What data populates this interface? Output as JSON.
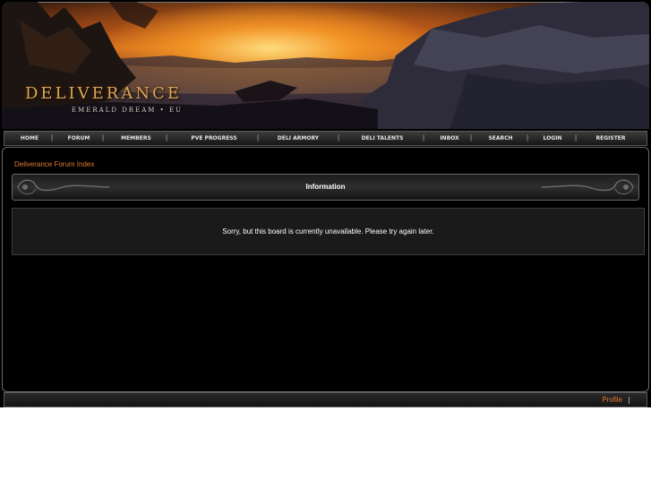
{
  "banner": {
    "logo_text": "DELIVERANCE",
    "tagline": "EMERALD DREAM • EU"
  },
  "nav": {
    "items": [
      {
        "label": "HOME"
      },
      {
        "label": "FORUM"
      },
      {
        "label": "MEMBERS"
      },
      {
        "label": "PVE PROGRESS"
      },
      {
        "label": "DELI ARMORY"
      },
      {
        "label": "DELI TALENTS"
      },
      {
        "label": "INBOX"
      },
      {
        "label": "SEARCH"
      },
      {
        "label": "LOGIN"
      },
      {
        "label": "REGISTER"
      }
    ],
    "separator": "|"
  },
  "main": {
    "breadcrumb": "Deliverance Forum Index",
    "info_title": "Information",
    "message": "Sorry, but this board is currently unavailable. Please try again later."
  },
  "footer": {
    "profile_label": "Profile",
    "separator": "|"
  },
  "colors": {
    "link": "#e07a30",
    "background": "#000000",
    "border": "#6a6a6a"
  }
}
